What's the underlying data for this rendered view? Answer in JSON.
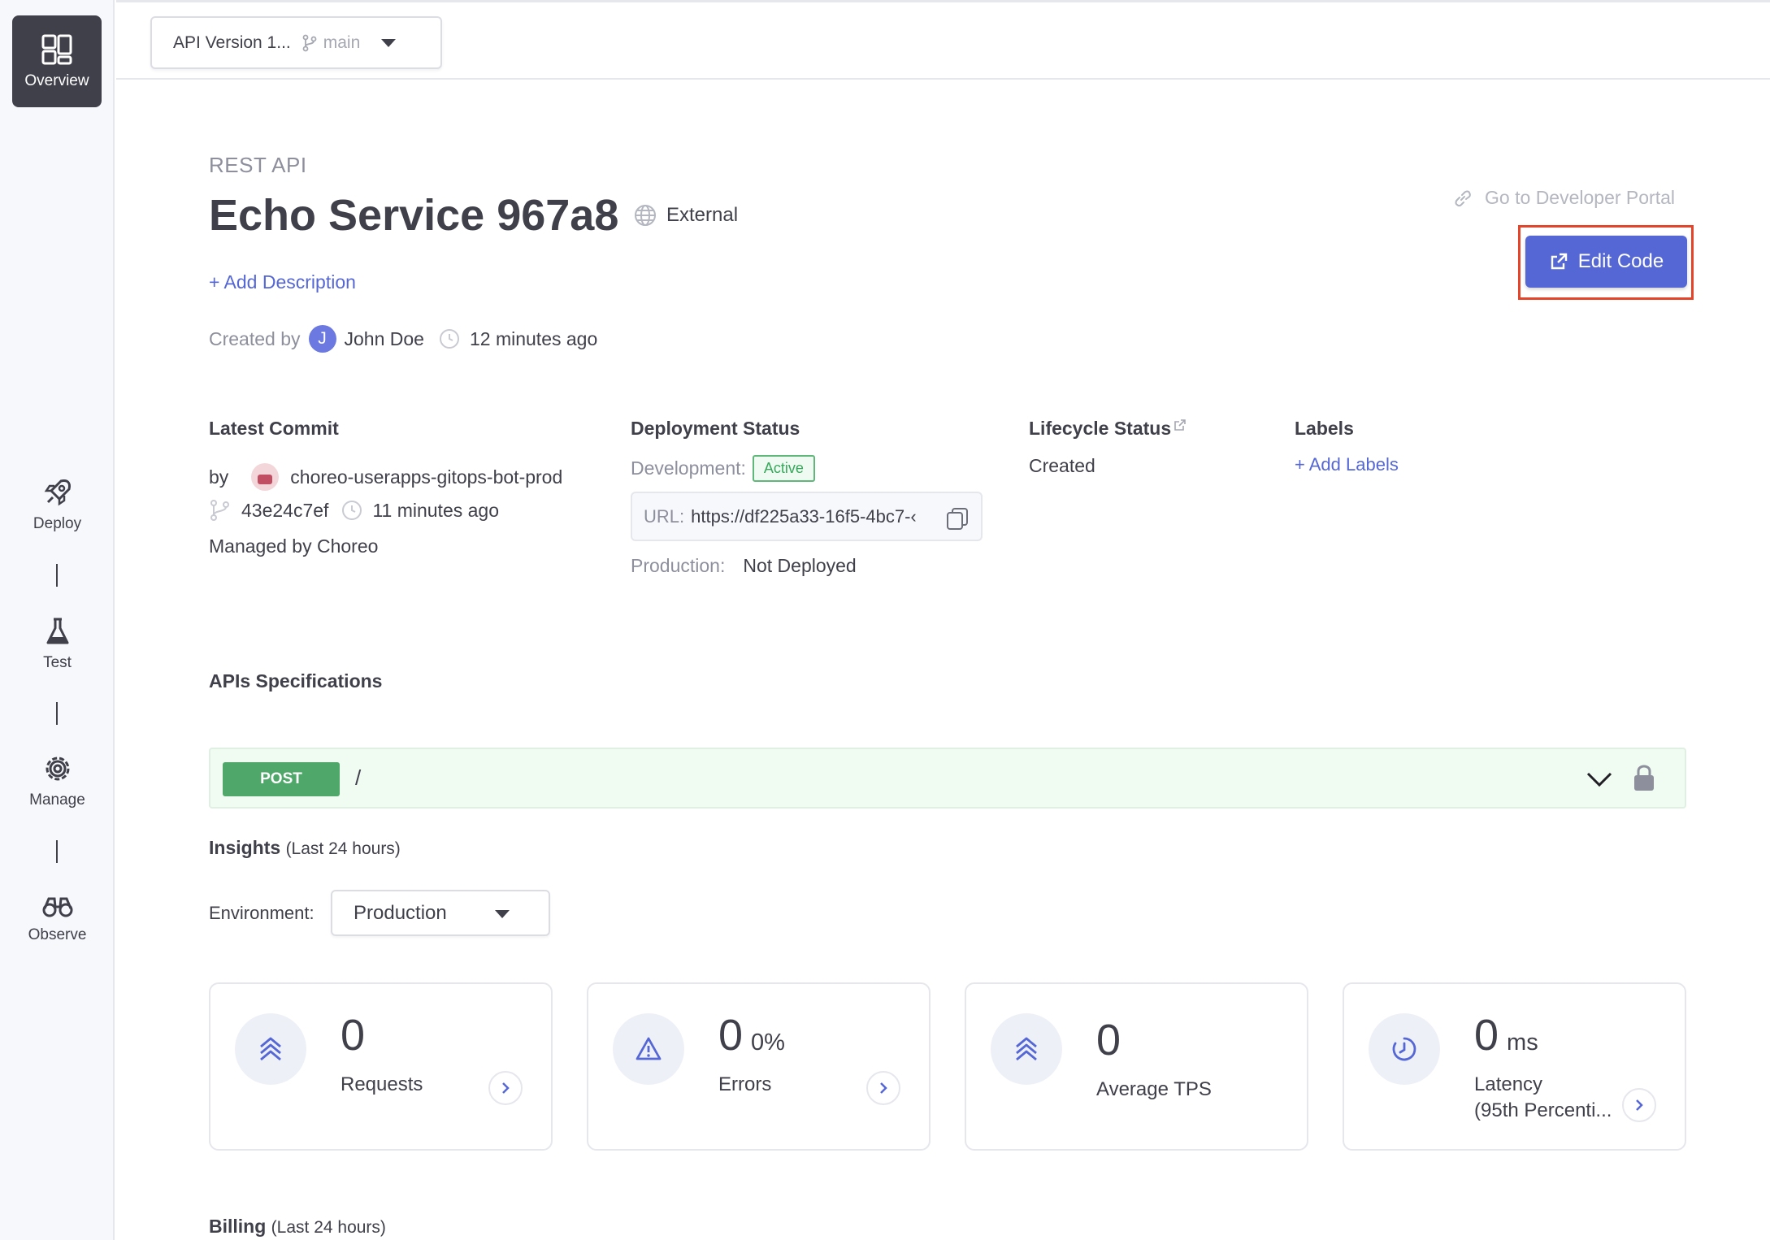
{
  "sidebar": {
    "items": [
      {
        "label": "Overview",
        "icon": "overview-icon"
      },
      {
        "label": "Deploy",
        "icon": "rocket-icon"
      },
      {
        "label": "Test",
        "icon": "flask-icon"
      },
      {
        "label": "Manage",
        "icon": "gear-icon"
      },
      {
        "label": "Observe",
        "icon": "binoculars-icon"
      }
    ]
  },
  "topbar": {
    "version_label": "API Version 1...",
    "branch": "main"
  },
  "header": {
    "api_type": "REST API",
    "title": "Echo Service 967a8",
    "visibility": "External",
    "add_description": "+ Add Description",
    "created_by_label": "Created by",
    "author_initial": "J",
    "author": "John Doe",
    "created_time": "12 minutes ago",
    "dev_portal_link": "Go to Developer Portal",
    "edit_code_label": "Edit Code"
  },
  "latest_commit": {
    "title": "Latest Commit",
    "by_label": "by",
    "committer": "choreo-userapps-gitops-bot-prod",
    "hash": "43e24c7ef",
    "time": "11 minutes ago",
    "managed": "Managed by Choreo"
  },
  "deployment_status": {
    "title": "Deployment Status",
    "dev_label": "Development:",
    "dev_status": "Active",
    "url_label": "URL:",
    "url_value": "https://df225a33-16f5-4bc7-‹",
    "prod_label": "Production:",
    "prod_status": "Not Deployed"
  },
  "lifecycle": {
    "title": "Lifecycle Status",
    "value": "Created"
  },
  "labels": {
    "title": "Labels",
    "add": "+ Add Labels"
  },
  "api_spec": {
    "title": "APIs Specifications",
    "method": "POST",
    "path": "/"
  },
  "insights": {
    "title": "Insights",
    "period": "(Last 24 hours)",
    "env_label": "Environment:",
    "env_value": "Production",
    "cards": [
      {
        "value": "0",
        "unit": "",
        "label": "Requests",
        "label2": "",
        "icon": "requests-icon"
      },
      {
        "value": "0",
        "unit": "0%",
        "label": "Errors",
        "label2": "",
        "icon": "warning-icon"
      },
      {
        "value": "0",
        "unit": "",
        "label": "Average TPS",
        "label2": "",
        "icon": "tps-icon"
      },
      {
        "value": "0",
        "unit": "ms",
        "label": "Latency",
        "label2": "(95th Percenti...",
        "icon": "latency-icon"
      }
    ]
  },
  "billing": {
    "title": "Billing",
    "period": "(Last 24 hours)"
  },
  "colors": {
    "accent": "#5567d5",
    "text": "#40404b",
    "muted": "#8d8f9c",
    "success": "#4fa86a",
    "highlight": "#e4452a"
  }
}
